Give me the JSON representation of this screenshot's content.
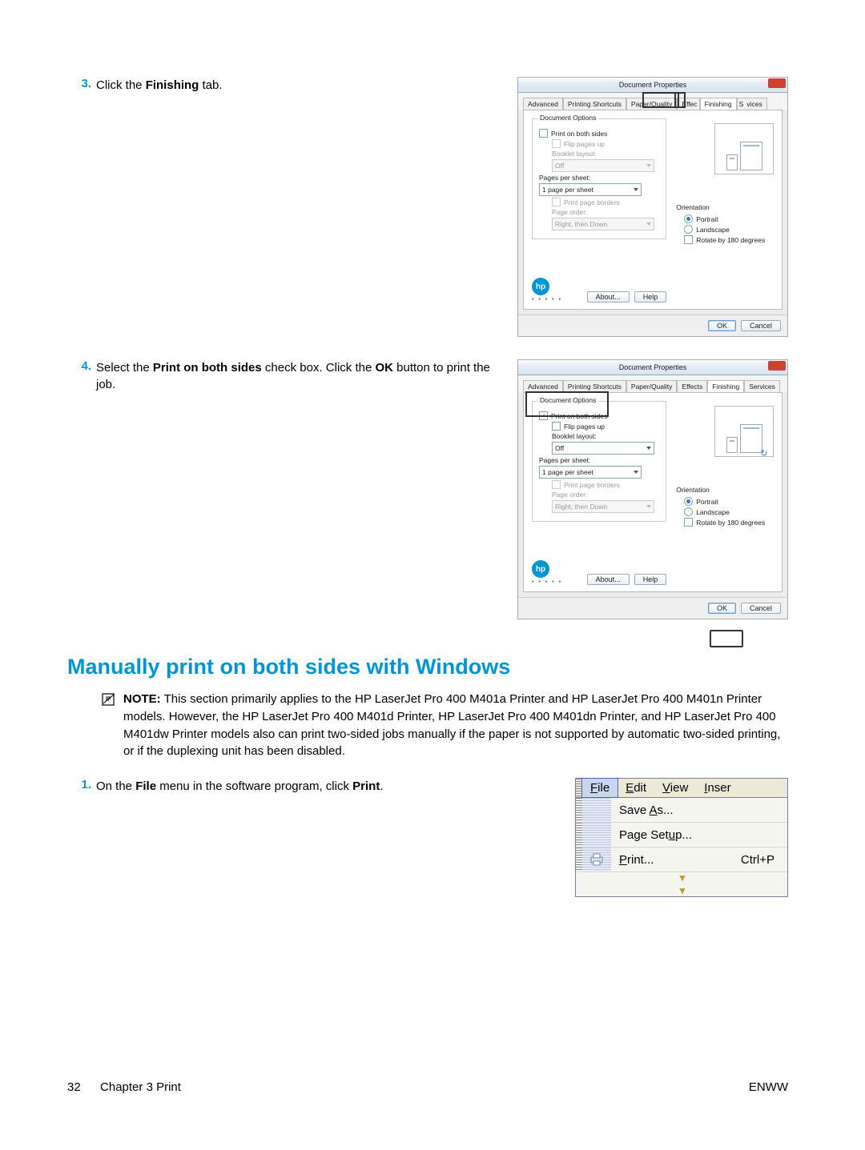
{
  "steps": {
    "s3": {
      "num": "3.",
      "text_a": "Click the ",
      "bold_a": "Finishing",
      "text_b": " tab."
    },
    "s4": {
      "num": "4.",
      "text_a": "Select the ",
      "bold_a": "Print on both sides",
      "text_b": " check box. Click the ",
      "bold_b": "OK",
      "text_c": " button to print the job."
    },
    "s1": {
      "num": "1.",
      "text_a": "On the ",
      "bold_a": "File",
      "text_b": " menu in the software program, click ",
      "bold_b": "Print",
      "text_c": "."
    }
  },
  "section_heading": "Manually print on both sides with Windows",
  "note": {
    "label": "NOTE:",
    "body": "This section primarily applies to the HP LaserJet Pro 400 M401a Printer and HP LaserJet Pro 400 M401n Printer models. However, the HP LaserJet Pro 400 M401d Printer, HP LaserJet Pro 400 M401dn Printer, and HP LaserJet Pro 400 M401dw Printer models also can print two-sided jobs manually if the paper is not supported by automatic two-sided printing, or if the duplexing unit has been disabled."
  },
  "dialog": {
    "title": "Document Properties",
    "tabs": [
      "Advanced",
      "Printing Shortcuts",
      "Paper/Quality",
      "Effects",
      "Finishing",
      "Services"
    ],
    "active_tab": "Finishing",
    "group_doc_options": "Document Options",
    "print_both_sides": "Print on both sides",
    "flip_pages_up": "Flip pages up",
    "booklet_layout": "Booklet layout:",
    "booklet_value": "Off",
    "pages_per_sheet": "Pages per sheet:",
    "pps_value": "1 page per sheet",
    "print_page_borders": "Print page borders",
    "page_order": "Page order:",
    "page_order_value": "Right, then Down",
    "orientation": "Orientation",
    "portrait": "Portrait",
    "landscape": "Landscape",
    "rotate": "Rotate by 180 degrees",
    "about": "About...",
    "help": "Help",
    "ok": "OK",
    "cancel": "Cancel",
    "hp": "hp"
  },
  "filemenu": {
    "file": "File",
    "edit": "Edit",
    "view": "View",
    "insert": "Inser",
    "save_as": "Save As...",
    "page_setup": "Page Setup...",
    "print": "Print...",
    "print_shortcut": "Ctrl+P"
  },
  "footer": {
    "page_num": "32",
    "chapter": "Chapter 3   Print",
    "right": "ENWW"
  }
}
